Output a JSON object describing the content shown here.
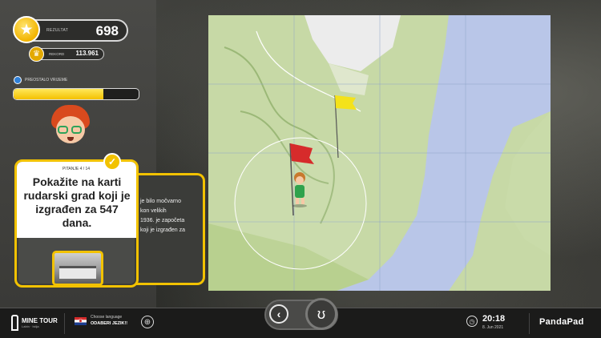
{
  "score": {
    "label": "REZULTAT",
    "value": "698",
    "icon": "star-icon"
  },
  "record": {
    "label": "REKORD",
    "value": "113.961",
    "icon": "trophy-icon"
  },
  "timer": {
    "label": "PREOSTALO VRIJEME",
    "fraction_remaining": 0.72,
    "icon": "clock-icon"
  },
  "question": {
    "counter": "PITANJE 4 / 14",
    "text": "Pokažite na karti rudarski grad koji je izgrađen za 547 dana.",
    "hint_text": "je bilo močvarno\nkon velikih\n1936. je započeta\nkoji je izgrađen za"
  },
  "map": {
    "colors": {
      "sea": "#b9c6e8",
      "land": "#c7d9a6",
      "town": "#ececec",
      "circle": "#ffffff"
    },
    "flags": [
      {
        "color": "#d62b2b",
        "name": "red-flag"
      },
      {
        "color": "#f4e21a",
        "name": "yellow-flag"
      }
    ]
  },
  "bottom": {
    "logo": {
      "title": "MINE TOUR",
      "subtitle": "Labin · Istija"
    },
    "language": {
      "label": "Choose language",
      "value": "ODABERI JEZIK!!"
    },
    "clock": {
      "time": "20:18",
      "date": "8. Jun 2021"
    },
    "brand": "PandaPad"
  },
  "colors": {
    "accent": "#f2c200",
    "panel": "#4a4b48"
  }
}
